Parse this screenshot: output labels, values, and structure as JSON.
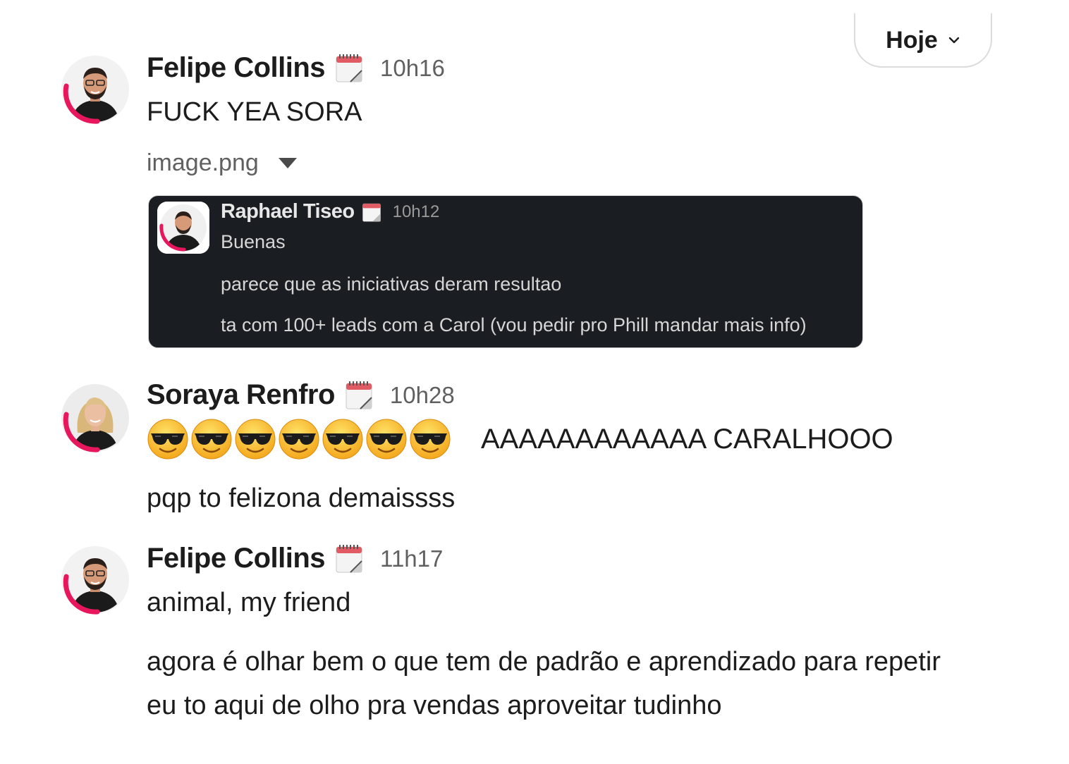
{
  "date_divider": {
    "label": "Hoje"
  },
  "messages": [
    {
      "author": "Felipe Collins",
      "time": "10h16",
      "lines": [
        "FUCK YEA SORA"
      ],
      "attachment": {
        "filename": "image.png",
        "embed": {
          "author": "Raphael Tiseo",
          "time": "10h12",
          "lines": [
            "Buenas",
            "parece que as iniciativas deram resultao",
            "ta com 100+ leads com a Carol (vou pedir pro Phill mandar mais info)"
          ]
        }
      }
    },
    {
      "author": "Soraya Renfro",
      "time": "10h28",
      "emoji": {
        "name": "sunglasses-emoji",
        "count": 7
      },
      "emoji_text": "AAAAAAAAAAAA CARALHOOO",
      "lines": [
        "pqp to felizona demaissss"
      ]
    },
    {
      "author": "Felipe Collins",
      "time": "11h17",
      "lines": [
        "animal, my friend",
        "agora é olhar bem o que tem de padrão e aprendizado para repetir",
        "eu to aqui de olho pra vendas aproveitar tudinho"
      ]
    }
  ],
  "colors": {
    "accent_ring": "#e8175d",
    "embed_bg": "#1a1d21",
    "timestamp": "#616061"
  },
  "icons": {
    "status": "calendar-icon",
    "dropdown": "chevron-down-icon",
    "attachment_toggle": "caret-down-icon"
  }
}
